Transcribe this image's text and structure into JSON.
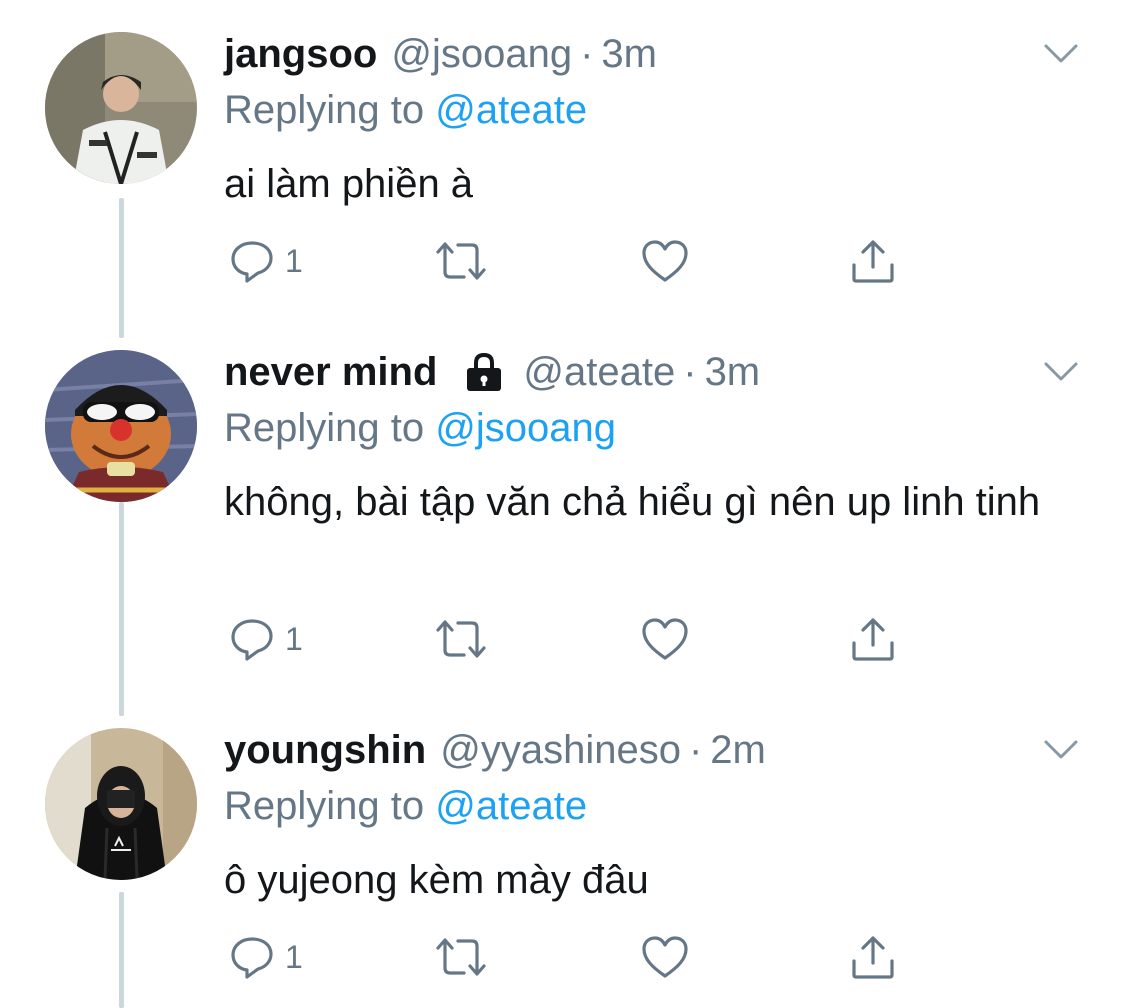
{
  "tweets": [
    {
      "name": "jangsoo",
      "handle": "@jsooang",
      "separator": "·",
      "time": "3m",
      "replying_prefix": "Replying to",
      "replying_to": "@ateate",
      "text": "ai làm phiền à",
      "reply_count": "1",
      "locked": false,
      "avatar": "photo of person in white jacket"
    },
    {
      "name": "never mind",
      "handle": "@ateate",
      "separator": "·",
      "time": "3m",
      "replying_prefix": "Replying to",
      "replying_to": "@jsooang",
      "text": "không, bài tập văn chả hiểu gì nên up linh tinh",
      "reply_count": "1",
      "locked": true,
      "avatar": "puppet with sunglasses and beanie"
    },
    {
      "name": "youngshin",
      "handle": "@yyashineso",
      "separator": "·",
      "time": "2m",
      "replying_prefix": "Replying to",
      "replying_to": "@ateate",
      "text": "ô yujeong kèm mày đâu",
      "reply_count": "1",
      "locked": false,
      "avatar": "mirror selfie in black hoodie"
    }
  ],
  "icons": {
    "reply": "reply-icon",
    "retweet": "retweet-icon",
    "like": "heart-icon",
    "share": "share-icon",
    "more": "chevron-down-icon",
    "protected": "lock-icon"
  },
  "colors": {
    "text": "#14171a",
    "secondary": "#657786",
    "link": "#1da1f2",
    "thread_line": "#ccd6dd"
  }
}
